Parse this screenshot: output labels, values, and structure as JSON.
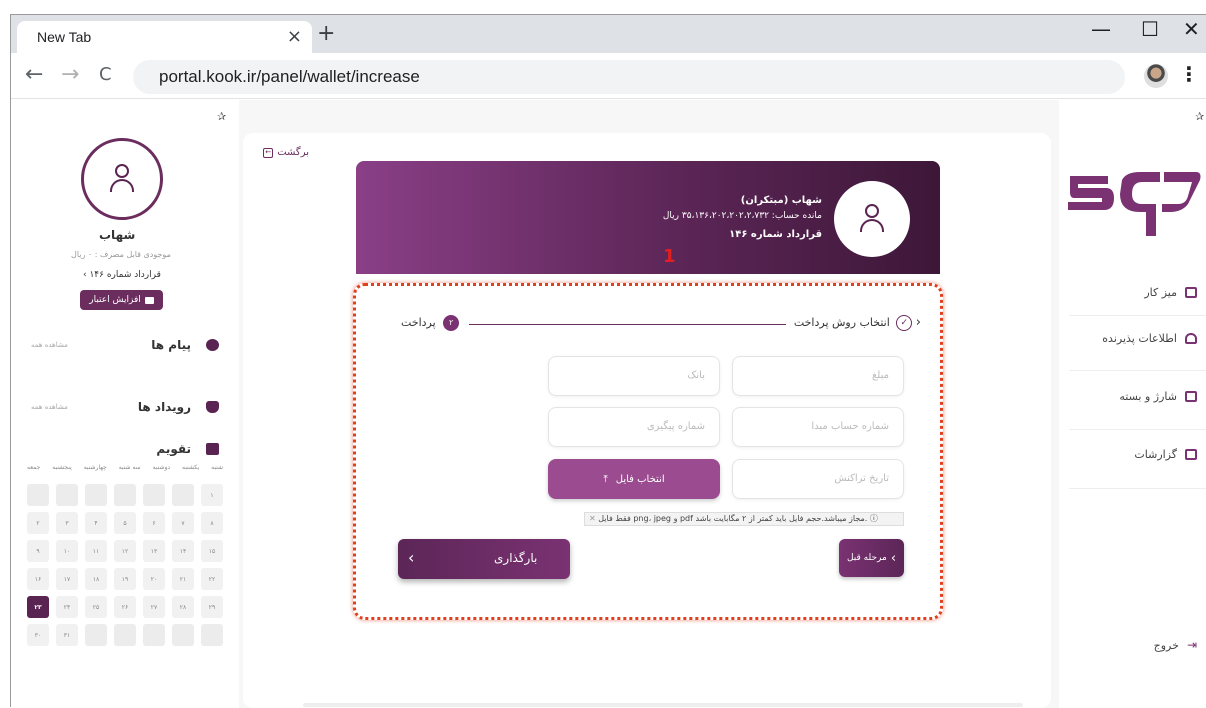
{
  "browser": {
    "tab_title": "New Tab",
    "tab_close": "×",
    "new_tab": "+",
    "minimize": "—",
    "maximize": "☐",
    "close": "✕",
    "back": "←",
    "forward": "→",
    "reload": "C",
    "url": "portal.kook.ir/panel/wallet/increase",
    "menu": "⋮"
  },
  "left_panel": {
    "user_name": "شهاب",
    "balance_text": "موجودی قابل مصرف : ۰ ریال",
    "contract": "قرارداد شماره ۱۴۶",
    "credit_button": "افزایش اعتبار",
    "messages_title": "پیام ها",
    "messages_see_all": "مشاهده همه",
    "events_title": "رویداد ها",
    "events_see_all": "مشاهده همه",
    "calendar_title": "تقویم",
    "weekdays": [
      "جمعه",
      "پنجشنبه",
      "چهارشنبه",
      "سه شنبه",
      "دوشنبه",
      "یکشنبه",
      "شنبه"
    ],
    "calendar_rows": [
      [
        "",
        "",
        "",
        "",
        "",
        "",
        "۱"
      ],
      [
        "۲",
        "۳",
        "۴",
        "۵",
        "۶",
        "۷",
        "۸"
      ],
      [
        "۹",
        "۱۰",
        "۱۱",
        "۱۲",
        "۱۳",
        "۱۴",
        "۱۵"
      ],
      [
        "۱۶",
        "۱۷",
        "۱۸",
        "۱۹",
        "۲۰",
        "۲۱",
        "۲۲"
      ],
      [
        "۲۳",
        "۲۴",
        "۲۵",
        "۲۶",
        "۲۷",
        "۲۸",
        "۲۹"
      ],
      [
        "۳۰",
        "۳۱",
        "",
        "",
        "",
        "",
        ""
      ]
    ],
    "today": "۲۳"
  },
  "card": {
    "back_label": "برگشت",
    "user_title": "شهاب (مبتکران)",
    "account_balance": "مانده حساب: ۳۵،۱۳۶،۲۰۲،۲۰۲،۲،۷۳۲ ریال",
    "contract": "قرارداد شماره ۱۴۶",
    "annotation_number": "1",
    "step1_label": "انتخاب روش پرداخت",
    "step2_label": "پرداخت",
    "step2_number": "۲",
    "check_mark": "✓",
    "amount_placeholder": "مبلغ",
    "bank_placeholder": "بانک",
    "source_account_placeholder": "شماره حساب مبدا",
    "tracking_placeholder": "شماره پیگیری",
    "transaction_date_placeholder": "تاریخ تراکنش",
    "file_select_label": "انتخاب فایل",
    "file_note": "فقط فایل png، jpeg و pdf مجاز میباشد.حجم فایل باید کمتر از ۲ مگابایت باشد.",
    "upload_button": "بارگذاری",
    "prev_button": "مرحله قبل"
  },
  "right_panel": {
    "items": [
      {
        "label": "میز کار",
        "icon": "desk-icon"
      },
      {
        "label": "اطلاعات پذیرنده",
        "icon": "user-info-icon"
      },
      {
        "label": "شارژ و بسته",
        "icon": "charge-icon"
      },
      {
        "label": "گزارشات",
        "icon": "report-icon"
      }
    ],
    "logout": "خروج"
  },
  "colors": {
    "brand": "#6a2d5e",
    "brand_light": "#9b4b8f",
    "annotation": "#e0401d"
  }
}
